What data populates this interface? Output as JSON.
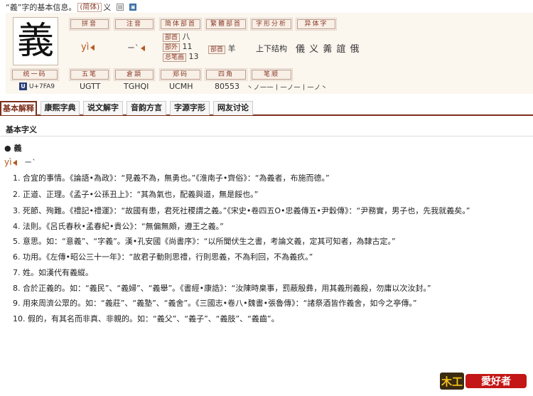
{
  "header": {
    "text": "“義”字的基本信息。",
    "trad_badge": "(简体)",
    "simp": "义"
  },
  "character": "義",
  "fields": {
    "pinyin": {
      "label": "拼音",
      "value": "yì"
    },
    "zhuyin": {
      "label": "注音",
      "value": "ㄧˋ"
    },
    "simp_radical": {
      "label": "简体部首",
      "radical_tag": "部首",
      "radical": "八",
      "outer_tag": "部外",
      "outer": "11",
      "total_tag": "总笔画",
      "total": "13"
    },
    "trad_radical": {
      "label": "繁體部首",
      "tag": "部首",
      "value": "羊"
    },
    "structure": {
      "label": "字形分析",
      "value": "上下结构"
    },
    "variants": {
      "label": "异体字",
      "value": "儀 义 羛 誼 俄"
    },
    "unicode": {
      "label": "统一码",
      "value": "U+7FA9",
      "icon": "U"
    },
    "wubi": {
      "label": "五笔",
      "value": "UGTT"
    },
    "cangjie": {
      "label": "倉頡",
      "value": "TGHQI"
    },
    "zhengma": {
      "label": "郑码",
      "value": "UCMH"
    },
    "sijiao": {
      "label": "四角",
      "value": "80553"
    },
    "bishun": {
      "label": "笔顺",
      "value": "丶ノ一一丨一ノ一丨一ノ丶"
    }
  },
  "tabs": [
    {
      "label": "基本解释",
      "active": true
    },
    {
      "label": "康熙字典",
      "active": false
    },
    {
      "label": "说文解字",
      "active": false
    },
    {
      "label": "音韵方言",
      "active": false
    },
    {
      "label": "字源字形",
      "active": false
    },
    {
      "label": "网友讨论",
      "active": false
    }
  ],
  "section_title": "基本字义",
  "entry": {
    "bullet": "●",
    "char": "義",
    "pinyin": "yì",
    "zhuyin": "ㄧˋ"
  },
  "definitions": [
    "1.  合宜的事情。《論語•為政》：“見義不為，無勇也。”《淮南子•齊俗》：“為義者，布施而德。”",
    "2.  正道、正理。《孟子•公孫丑上》：“其為氣也，配義與道，無是餒也。”",
    "3.  死節、殉難。《禮記•禮運》：“故國有患，君死社稷謂之義。”《宋史•卷四五O•忠義傳五•尹穀傳》：“尹務實，男子也，先我就義矣。”",
    "4.  法則。《呂氏春秋•孟春紀•貴公》：“無偏無頗，遵王之義。”",
    "5.  意思。如：“意義”、“字義”。漢•孔安國《尚書序》：“以所聞伏生之書，考論文義，定其可知者，為隸古定。”",
    "6.  功用。《左傳•昭公三十一年》：“故君子動則思禮，行則思義，不為利回，不為義疚。”",
    "7.  姓。如漢代有義縱。",
    "8.  合於正義的。如：“義民”、“義婦”、“義舉”。《書經•康誥》：“汝陳時臬事，罰蔽殷彝，用其義刑義殺，勿庸以次汝封。”",
    "9.  用來周濟公眾的。如：“義莊”、“義塾”、“義舍”。《三國志•卷八•魏書•張魯傳》：“諸祭酒皆作義舍，如今之亭傳。”",
    "10.  假的，有其名而非真、非親的。如：“義父”、“義子”、“義肢”、“義齒”。"
  ],
  "logo": {
    "text": "愛好者",
    "mark": "木工"
  },
  "colors": {
    "accent": "#7d2f1b",
    "label_text": "#8a3b2a",
    "pron": "#b35a1f",
    "panel": "#fbf6ee"
  }
}
